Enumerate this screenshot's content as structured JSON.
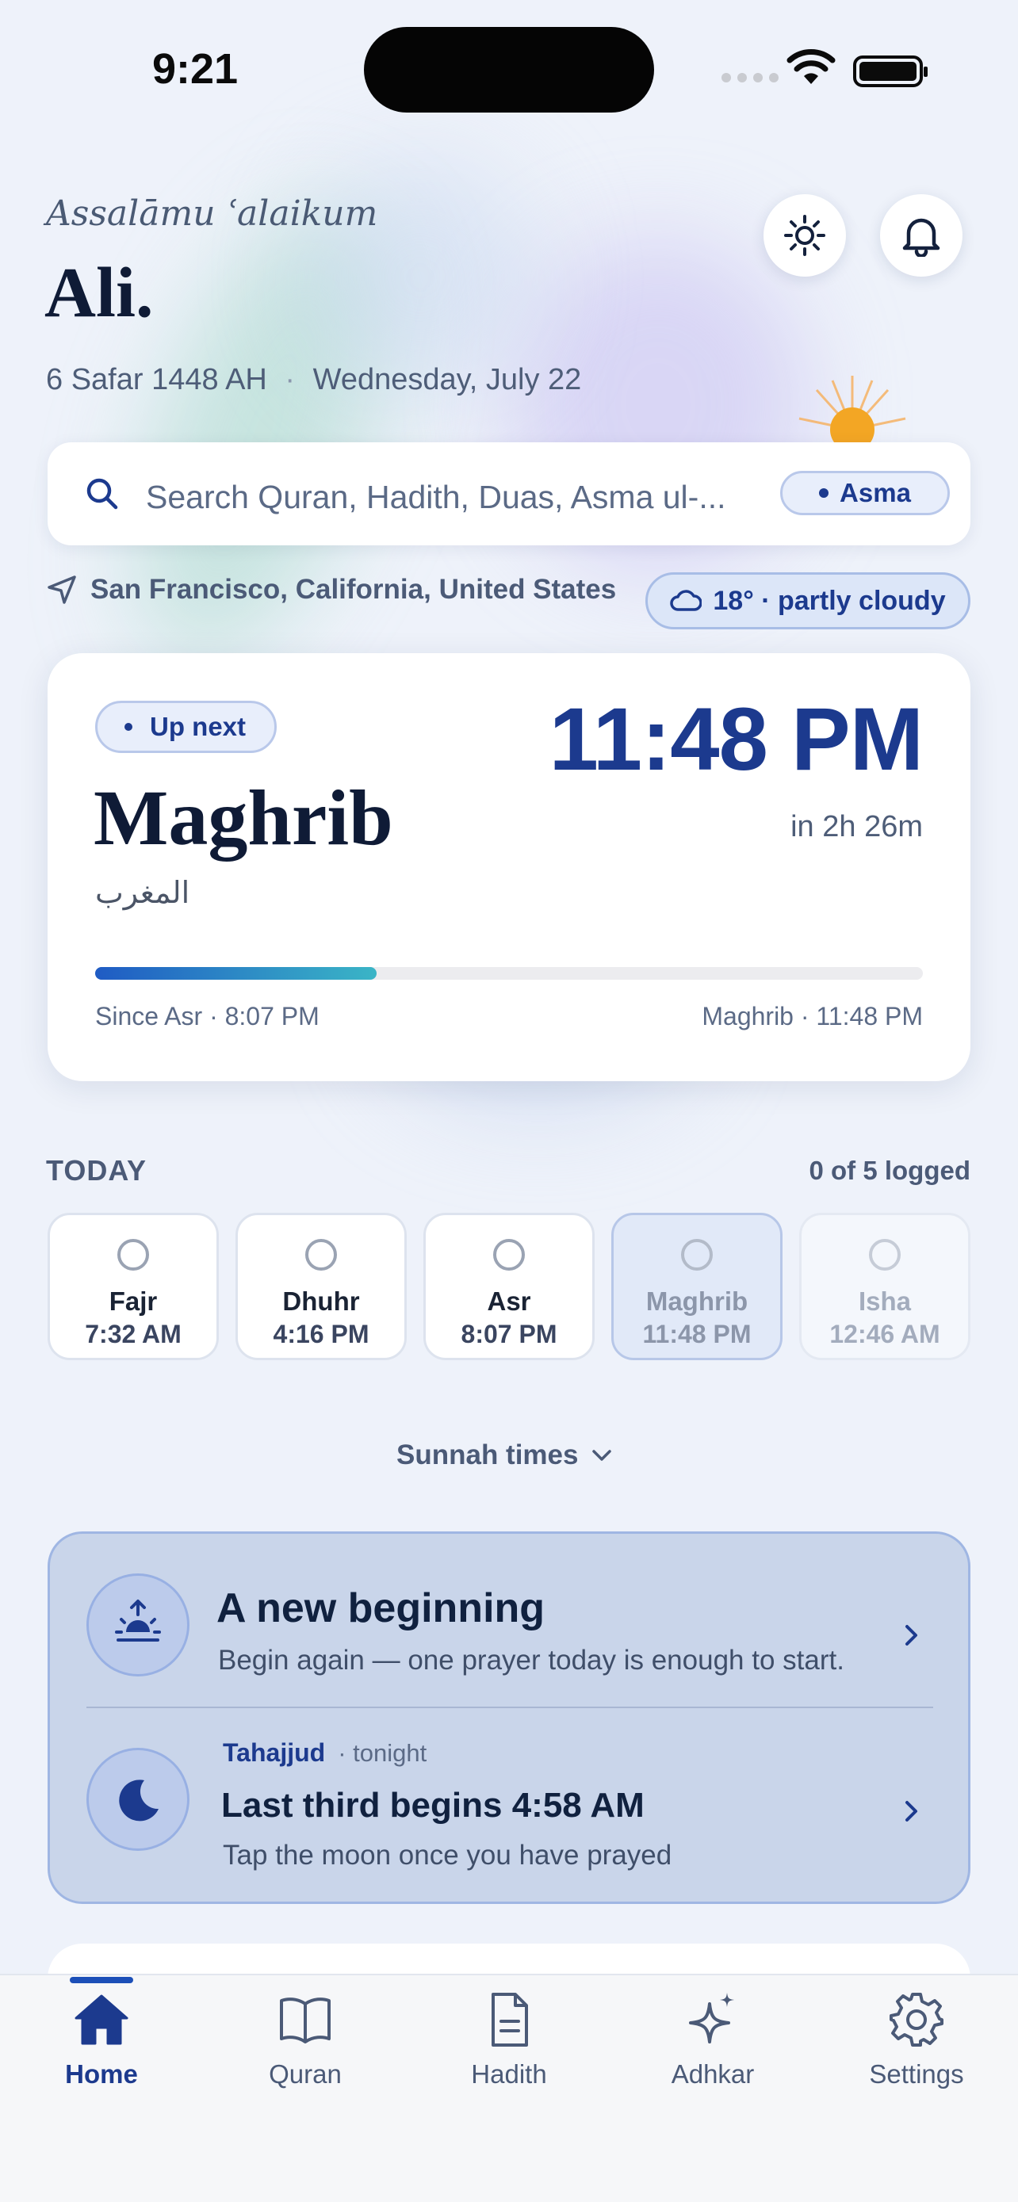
{
  "status_bar": {
    "time": "9:21"
  },
  "header": {
    "greeting": "Assalāmu ʿalaikum",
    "name": "Ali.",
    "hijri_date": "6 Safar 1448 AH",
    "separator": "·",
    "gregorian_date": "Wednesday, July 22",
    "icons": [
      "sun-icon",
      "bell-icon"
    ]
  },
  "search": {
    "placeholder": "Search Quran, Hadith, Duas, Asma ul-...",
    "chip_label": "Asma"
  },
  "location": {
    "place": "San Francisco, California, United States",
    "weather": "18° · partly cloudy"
  },
  "next_prayer": {
    "badge": "Up next",
    "name": "Maghrib",
    "arabic": "المغرب",
    "time": "11:48 PM",
    "countdown": "in 2h 26m",
    "progress": 0.34,
    "since_label": "Since Asr · 8:07 PM",
    "until_label": "Maghrib · 11:48 PM"
  },
  "today": {
    "label": "TODAY",
    "logged": "0 of 5 logged",
    "prayers": [
      {
        "name": "Fajr",
        "time": "7:32 AM",
        "state": "past"
      },
      {
        "name": "Dhuhr",
        "time": "4:16 PM",
        "state": "past"
      },
      {
        "name": "Asr",
        "time": "8:07 PM",
        "state": "past"
      },
      {
        "name": "Maghrib",
        "time": "11:48 PM",
        "state": "active"
      },
      {
        "name": "Isha",
        "time": "12:46 AM",
        "state": "future"
      }
    ]
  },
  "sunnah": {
    "label": "Sunnah times"
  },
  "info_card": {
    "beginning_title": "A new beginning",
    "beginning_sub": "Begin again — one prayer today is enough to start.",
    "tahajjud_label": "Tahajjud",
    "tahajjud_when": "· tonight",
    "tahajjud_title": "Last third begins 4:58 AM",
    "tahajjud_sub": "Tap the moon once you have prayed"
  },
  "tabs": [
    {
      "label": "Home",
      "icon": "home-icon",
      "active": true
    },
    {
      "label": "Quran",
      "icon": "book-icon",
      "active": false
    },
    {
      "label": "Hadith",
      "icon": "document-icon",
      "active": false
    },
    {
      "label": "Adhkar",
      "icon": "sparkle-icon",
      "active": false
    },
    {
      "label": "Settings",
      "icon": "gear-icon",
      "active": false
    }
  ],
  "colors": {
    "accent": "#1c3a8e",
    "progress_start": "#1f5bc4",
    "progress_end": "#3ab5c6",
    "background": "#eef2fa"
  }
}
